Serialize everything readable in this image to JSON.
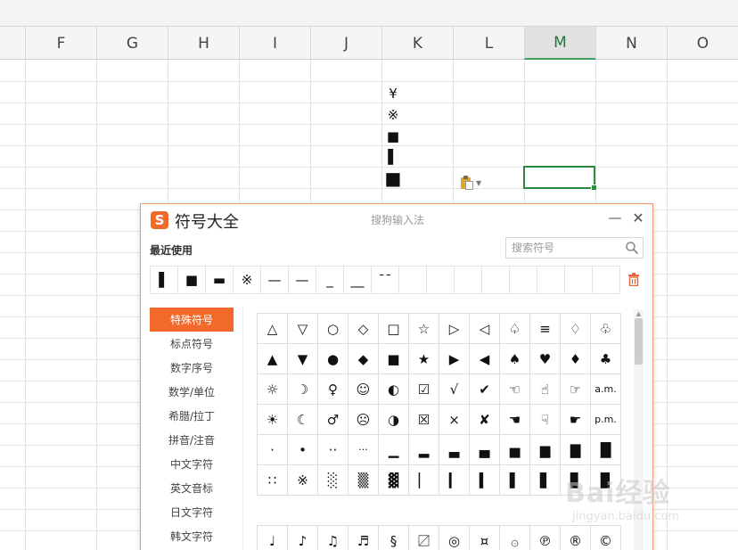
{
  "columns": [
    "F",
    "G",
    "H",
    "I",
    "J",
    "K",
    "L",
    "M",
    "N",
    "O"
  ],
  "active_column": "M",
  "cell_symbols": [
    "¥",
    "※",
    "■",
    "▌",
    "■"
  ],
  "dialog": {
    "title": "符号大全",
    "subtitle": "搜狗输入法",
    "logo_letter": "S",
    "minimize": "—",
    "close": "✕",
    "recent_label": "最近使用",
    "search_placeholder": "搜索符号",
    "recent_symbols": [
      "▌",
      "■",
      "▬",
      "※",
      "—",
      "—",
      "_",
      "__",
      "¯¯",
      "",
      "",
      "",
      "",
      "",
      "",
      "",
      ""
    ],
    "categories": [
      "特殊符号",
      "标点符号",
      "数字序号",
      "数学/单位",
      "希腊/拉丁",
      "拼音/注音",
      "中文字符",
      "英文音标",
      "日文字符",
      "韩文字符"
    ],
    "active_category": "特殊符号",
    "symbols": [
      [
        "△",
        "▽",
        "○",
        "◇",
        "□",
        "☆",
        "▷",
        "◁",
        "♤",
        "≡",
        "♢",
        "♧"
      ],
      [
        "▲",
        "▼",
        "●",
        "◆",
        "■",
        "★",
        "▶",
        "◀",
        "♠",
        "♥",
        "♦",
        "♣"
      ],
      [
        "☼",
        "☽",
        "♀",
        "☺",
        "◐",
        "☑",
        "√",
        "✔",
        "☜",
        "☝",
        "☞",
        "a.m."
      ],
      [
        "☀",
        "☾",
        "♂",
        "☹",
        "◑",
        "☒",
        "×",
        "✘",
        "☚",
        "☟",
        "☛",
        "p.m."
      ],
      [
        "·",
        "•",
        "··",
        "···",
        "▁",
        "▂",
        "▃",
        "▄",
        "▅",
        "▆",
        "▇",
        "█"
      ],
      [
        "∷",
        "※",
        "░",
        "▒",
        "▓",
        "▏",
        "▎",
        "▍",
        "▌",
        "▋",
        "▊",
        "▉"
      ]
    ],
    "symbols_row2": [
      "♩",
      "♪",
      "♫",
      "♬",
      "§",
      "〼",
      "◎",
      "¤",
      "۞",
      "℗",
      "®",
      "©"
    ]
  },
  "watermark": {
    "text": "Bai经验",
    "sub": "jingyan.baidu.com"
  }
}
